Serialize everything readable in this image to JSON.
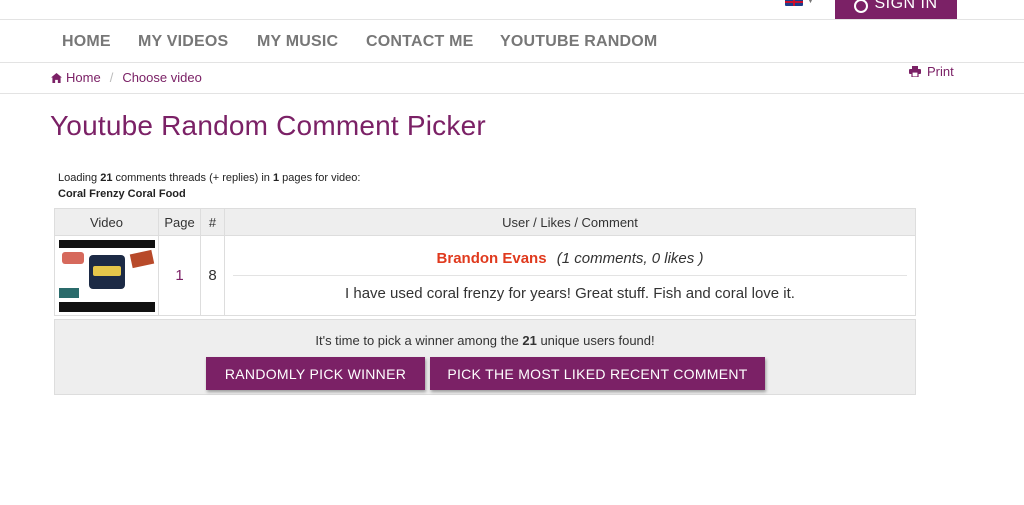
{
  "header": {
    "language": "en-GB",
    "signin_label": "SIGN IN"
  },
  "nav": {
    "items": [
      "HOME",
      "MY VIDEOS",
      "MY MUSIC",
      "CONTACT ME",
      "YOUTUBE RANDOM"
    ]
  },
  "breadcrumb": {
    "home": "Home",
    "current": "Choose video",
    "separator": "/"
  },
  "print_label": "Print",
  "page_title": "Youtube Random Comment Picker",
  "loading": {
    "prefix": "Loading",
    "threads": "21",
    "middle": "comments threads (+ replies) in",
    "pages": "1",
    "suffix": "pages for video:",
    "video_title": "Coral Frenzy Coral Food"
  },
  "table": {
    "headers": [
      "Video",
      "Page",
      "#",
      "User / Likes / Comment"
    ],
    "row": {
      "page": "1",
      "index": "8",
      "user": "Brandon Evans",
      "meta": "(1 comments, 0 likes )",
      "comment": "I have used coral frenzy for years! Great stuff. Fish and coral love it."
    }
  },
  "pick": {
    "text_prefix": "It's time to pick a winner among the",
    "unique_users": "21",
    "text_suffix": "unique users found!",
    "random_button": "RANDOMLY PICK WINNER",
    "liked_button": "PICK THE MOST LIKED RECENT COMMENT"
  },
  "colors": {
    "brand": "#7b2166",
    "user_name": "#e03a1e"
  }
}
